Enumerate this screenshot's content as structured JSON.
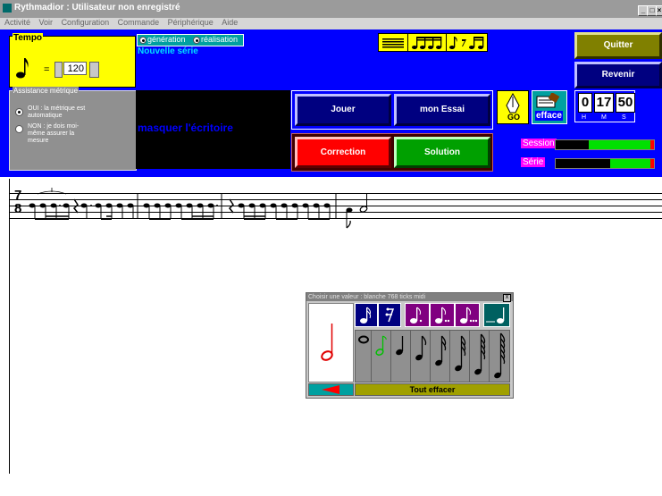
{
  "window": {
    "title": "Rythmadior  :  Utilisateur non enregistré",
    "controls": [
      "_",
      "□",
      "×"
    ]
  },
  "menu": [
    "Activité",
    "Voir",
    "Configuration",
    "Commande",
    "Périphérique",
    "Aide"
  ],
  "tempo": {
    "label": "Tempo",
    "equals": "=",
    "value": "120"
  },
  "mode": {
    "generation": "génération",
    "realisation": "réalisation",
    "selected": "réalisation",
    "subtitle": "Nouvelle série"
  },
  "metric": {
    "label": "Assistance métrique",
    "oui": "OUI : la métrique est automatique",
    "non": "NON : je dois moi-même assurer la mesure",
    "selected": "oui"
  },
  "black_panel": {
    "masquer": "masquer l'écritoire"
  },
  "buttons": {
    "jouer": "Jouer",
    "mon_essai": "mon Essai",
    "correction": "Correction",
    "solution": "Solution",
    "quitter": "Quitter",
    "revenir": "Revenir",
    "go": "GO",
    "efface": "efface"
  },
  "timer": {
    "h": "0",
    "m": "17",
    "s": "50",
    "h_label": "H",
    "m_label": "M",
    "s_label": "S"
  },
  "progress": {
    "session_label": "Session",
    "serie_label": "Série",
    "session_fraction": 0.65,
    "serie_fraction": 0.42
  },
  "score": {
    "time_signature": [
      "7",
      "8"
    ]
  },
  "dialog": {
    "title": "Choisir une valeur : blanche      768 ticks midi",
    "close": "x",
    "tout_effacer": "Tout effacer"
  },
  "colors": {
    "panel_blue": "#0000ff",
    "yellow": "#ffff00",
    "navy": "#000080",
    "red": "#ff0000",
    "green": "#00a000",
    "olive": "#808000",
    "magenta": "#ff00ff"
  }
}
